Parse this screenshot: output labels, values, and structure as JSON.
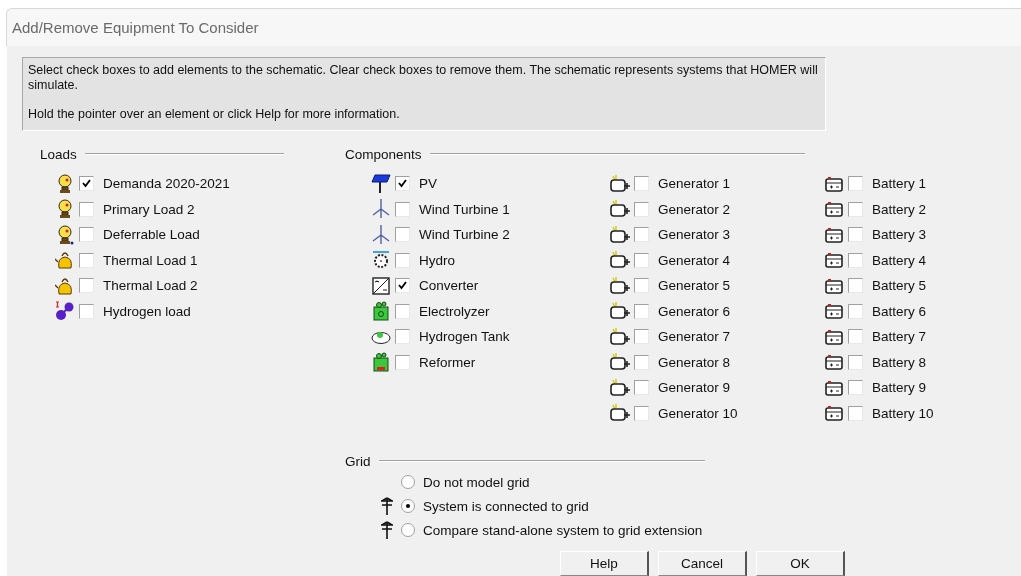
{
  "window": {
    "title": "Add/Remove Equipment To Consider"
  },
  "info": {
    "lines": [
      "Select check boxes to add elements to the schematic. Clear check boxes to remove them. The schematic represents systems that HOMER will simulate.",
      "Hold the pointer over an element or click Help for more information."
    ]
  },
  "loads": {
    "heading": "Loads",
    "items": [
      {
        "label": "Demanda 2020-2021",
        "kind": "primary",
        "checked": true
      },
      {
        "label": "Primary Load 2",
        "kind": "primary",
        "checked": false
      },
      {
        "label": "Deferrable Load",
        "kind": "deferrable",
        "checked": false
      },
      {
        "label": "Thermal Load 1",
        "kind": "thermal",
        "checked": false
      },
      {
        "label": "Thermal Load 2",
        "kind": "thermal",
        "checked": false
      },
      {
        "label": "Hydrogen load",
        "kind": "hydrogen",
        "checked": false
      }
    ]
  },
  "components": {
    "heading": "Components",
    "columns": [
      [
        {
          "label": "PV",
          "kind": "pv",
          "checked": true
        },
        {
          "label": "Wind Turbine 1",
          "kind": "wind",
          "checked": false
        },
        {
          "label": "Wind Turbine 2",
          "kind": "wind",
          "checked": false
        },
        {
          "label": "Hydro",
          "kind": "hydro",
          "checked": false
        },
        {
          "label": "Converter",
          "kind": "converter",
          "checked": true
        },
        {
          "label": "Electrolyzer",
          "kind": "electrolyzer",
          "checked": false
        },
        {
          "label": "Hydrogen Tank",
          "kind": "tank",
          "checked": false
        },
        {
          "label": "Reformer",
          "kind": "reformer",
          "checked": false
        }
      ],
      [
        {
          "label": "Generator 1",
          "kind": "generator",
          "checked": false
        },
        {
          "label": "Generator 2",
          "kind": "generator",
          "checked": false
        },
        {
          "label": "Generator 3",
          "kind": "generator",
          "checked": false
        },
        {
          "label": "Generator 4",
          "kind": "generator",
          "checked": false
        },
        {
          "label": "Generator 5",
          "kind": "generator",
          "checked": false
        },
        {
          "label": "Generator 6",
          "kind": "generator",
          "checked": false
        },
        {
          "label": "Generator 7",
          "kind": "generator",
          "checked": false
        },
        {
          "label": "Generator 8",
          "kind": "generator",
          "checked": false
        },
        {
          "label": "Generator 9",
          "kind": "generator",
          "checked": false
        },
        {
          "label": "Generator 10",
          "kind": "generator",
          "checked": false
        }
      ],
      [
        {
          "label": "Battery 1",
          "kind": "battery",
          "checked": false
        },
        {
          "label": "Battery 2",
          "kind": "battery",
          "checked": false
        },
        {
          "label": "Battery 3",
          "kind": "battery",
          "checked": false
        },
        {
          "label": "Battery 4",
          "kind": "battery",
          "checked": false
        },
        {
          "label": "Battery 5",
          "kind": "battery",
          "checked": false
        },
        {
          "label": "Battery 6",
          "kind": "battery",
          "checked": false
        },
        {
          "label": "Battery 7",
          "kind": "battery",
          "checked": false
        },
        {
          "label": "Battery 8",
          "kind": "battery",
          "checked": false
        },
        {
          "label": "Battery 9",
          "kind": "battery",
          "checked": false
        },
        {
          "label": "Battery 10",
          "kind": "battery",
          "checked": false
        }
      ]
    ]
  },
  "grid": {
    "heading": "Grid",
    "options": [
      {
        "label": "Do not model grid",
        "kind": "plain",
        "selected": false
      },
      {
        "label": "System is connected to grid",
        "kind": "grid",
        "selected": true
      },
      {
        "label": "Compare stand-alone system to grid extension",
        "kind": "grid",
        "selected": false
      }
    ]
  },
  "buttons": [
    "Help",
    "Cancel",
    "OK"
  ]
}
